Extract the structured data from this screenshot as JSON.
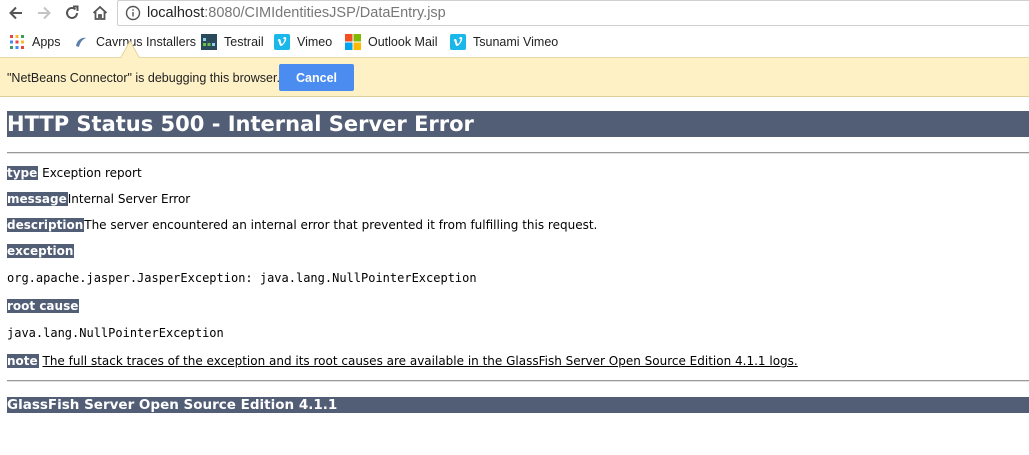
{
  "browser": {
    "url_host": "localhost",
    "url_path": ":8080/CIMIdentitiesJSP/DataEntry.jsp",
    "bookmarks": [
      {
        "label": "Apps",
        "icon": "apps-grid-icon"
      },
      {
        "label": "Cavrnus Installers",
        "icon": "cavrnus-icon"
      },
      {
        "label": "Testrail",
        "icon": "testrail-icon"
      },
      {
        "label": "Vimeo",
        "icon": "vimeo-icon"
      },
      {
        "label": "Outlook Mail",
        "icon": "microsoft-icon"
      },
      {
        "label": "Tsunami Vimeo",
        "icon": "vimeo-icon"
      }
    ]
  },
  "infobar": {
    "message": "\"NetBeans Connector\" is debugging this browser.",
    "cancel_label": "Cancel"
  },
  "error_page": {
    "title": "HTTP Status 500 - Internal Server Error",
    "type_label": "type",
    "type_value": "Exception report",
    "message_label": "message",
    "message_value": "Internal Server Error",
    "description_label": "description",
    "description_value": "The server encountered an internal error that prevented it from fulfilling this request.",
    "exception_label": "exception",
    "exception_value": "org.apache.jasper.JasperException: java.lang.NullPointerException",
    "root_cause_label": "root cause",
    "root_cause_value": "java.lang.NullPointerException",
    "note_label": "note",
    "note_value": "The full stack traces of the exception and its root causes are available in the GlassFish Server Open Source Edition 4.1.1 logs.",
    "footer": "GlassFish Server Open Source Edition 4.1.1"
  },
  "colors": {
    "header_bg": "#525d76",
    "infobar_bg": "#fff1c6",
    "cancel_bg": "#4a8cf0"
  }
}
